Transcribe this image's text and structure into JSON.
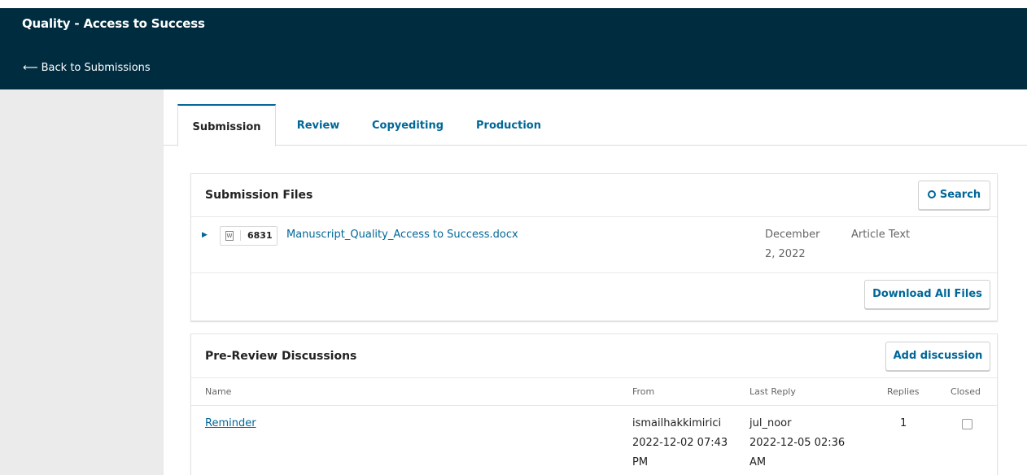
{
  "header": {
    "title": "Quality - Access to Success",
    "back_label": "Back to Submissions"
  },
  "tabs": [
    {
      "label": "Submission",
      "active": true
    },
    {
      "label": "Review"
    },
    {
      "label": "Copyediting"
    },
    {
      "label": "Production"
    }
  ],
  "submission_files": {
    "title": "Submission Files",
    "search_label": "Search",
    "file": {
      "id": "6831",
      "name": "Manuscript_Quality_Access to Success.docx",
      "date_line1": "December",
      "date_line2": "2, 2022",
      "type": "Article Text"
    },
    "download_all_label": "Download All Files"
  },
  "discussions": {
    "title": "Pre-Review Discussions",
    "add_label": "Add discussion",
    "columns": {
      "name": "Name",
      "from": "From",
      "last_reply": "Last Reply",
      "replies": "Replies",
      "closed": "Closed"
    },
    "rows": [
      {
        "name": "Reminder",
        "from_user": "ismailhakkimirici",
        "from_date": "2022-12-02 07:43",
        "from_ampm": "PM",
        "reply_user": "jul_noor",
        "reply_date": "2022-12-05 02:36",
        "reply_ampm": "AM",
        "replies": "1"
      }
    ]
  },
  "colors": {
    "header_bg": "#002c40",
    "link": "#006798",
    "sidebar_bg": "#ebebeb"
  }
}
